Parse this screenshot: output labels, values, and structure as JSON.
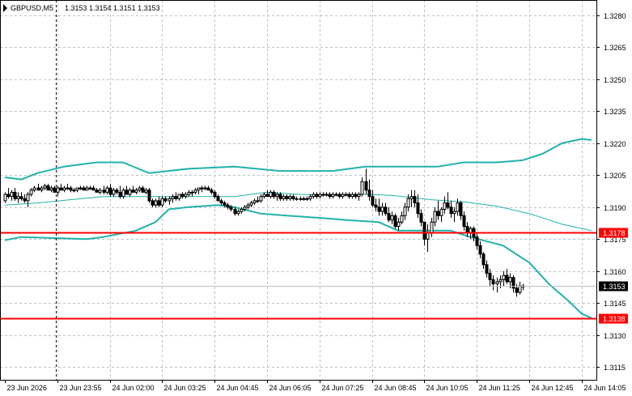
{
  "chart_data": {
    "type": "candlestick",
    "symbol_label": "GBPUSD,M5",
    "ohlc_label": "1.3153 1.3154 1.3151 1.3153",
    "y_ticks": [
      "1.3280",
      "1.3265",
      "1.3250",
      "1.3235",
      "1.3220",
      "1.3205",
      "1.3190",
      "1.3175",
      "1.3160",
      "1.3145",
      "1.3130",
      "1.3115"
    ],
    "y_tick_values": [
      1.328,
      1.3265,
      1.325,
      1.3235,
      1.322,
      1.3205,
      1.319,
      1.3175,
      1.316,
      1.3145,
      1.313,
      1.3115
    ],
    "ylim": [
      1.3109,
      1.32872
    ],
    "x_ticks": [
      "23 Jun 2026",
      "23 Jun 23:55",
      "24 Jun 02:00",
      "24 Jun 03:25",
      "24 Jun 04:45",
      "24 Jun 06:05",
      "24 Jun 07:25",
      "24 Jun 08:45",
      "24 Jun 10:05",
      "24 Jun 11:25",
      "24 Jun 12:45",
      "24 Jun 14:05"
    ],
    "x_tick_values": [
      0,
      16,
      32,
      48,
      64,
      80,
      96,
      112,
      128,
      144,
      160,
      176
    ],
    "xlim": [
      -1,
      184.2
    ],
    "levels": [
      {
        "label": "1.3178",
        "value": 1.3178,
        "color": "#ff0000"
      },
      {
        "label": "1.3138",
        "value": 1.3138,
        "color": "#ff0000"
      }
    ],
    "current_price": {
      "label": "1.3153",
      "value": 1.3153
    },
    "candles": [
      [
        1.3193,
        1.3197,
        1.3192,
        1.3196
      ],
      [
        1.3196,
        1.3199,
        1.3194,
        1.3195
      ],
      [
        1.3195,
        1.3198,
        1.3193,
        1.3197
      ],
      [
        1.3197,
        1.3199,
        1.3193,
        1.3194
      ],
      [
        1.3194,
        1.3197,
        1.3192,
        1.3195
      ],
      [
        1.3195,
        1.3197,
        1.3193,
        1.3194
      ],
      [
        1.3194,
        1.3196,
        1.3192,
        1.3193
      ],
      [
        1.3193,
        1.3197,
        1.319,
        1.3196
      ],
      [
        1.3196,
        1.3199,
        1.3195,
        1.3198
      ],
      [
        1.3198,
        1.32,
        1.3197,
        1.3199
      ],
      [
        1.3199,
        1.3201,
        1.3198,
        1.3198
      ],
      [
        1.3198,
        1.32,
        1.3197,
        1.3199
      ],
      [
        1.3199,
        1.3201,
        1.3198,
        1.32
      ],
      [
        1.32,
        1.3201,
        1.3198,
        1.3198
      ],
      [
        1.3198,
        1.32,
        1.3197,
        1.3199
      ],
      [
        1.3199,
        1.32,
        1.3197,
        1.3197
      ],
      [
        1.3197,
        1.32,
        1.3195,
        1.3199
      ],
      [
        1.3199,
        1.3201,
        1.3198,
        1.3198
      ],
      [
        1.3198,
        1.32,
        1.3197,
        1.3199
      ],
      [
        1.3199,
        1.3201,
        1.3198,
        1.3199
      ],
      [
        1.3199,
        1.32,
        1.3197,
        1.3198
      ],
      [
        1.3198,
        1.3199,
        1.3197,
        1.3198
      ],
      [
        1.3198,
        1.3199,
        1.3197,
        1.3199
      ],
      [
        1.3199,
        1.32,
        1.3198,
        1.3199
      ],
      [
        1.3199,
        1.32,
        1.3198,
        1.3198
      ],
      [
        1.3198,
        1.32,
        1.3198,
        1.3199
      ],
      [
        1.3199,
        1.32,
        1.3198,
        1.3199
      ],
      [
        1.3199,
        1.32,
        1.3198,
        1.3198
      ],
      [
        1.3198,
        1.3199,
        1.3197,
        1.3197
      ],
      [
        1.3197,
        1.3199,
        1.3196,
        1.3198
      ],
      [
        1.3198,
        1.32,
        1.3196,
        1.3197
      ],
      [
        1.3197,
        1.32,
        1.3196,
        1.3199
      ],
      [
        1.3199,
        1.3201,
        1.3195,
        1.3196
      ],
      [
        1.3196,
        1.3199,
        1.3195,
        1.3198
      ],
      [
        1.3198,
        1.3199,
        1.3196,
        1.3197
      ],
      [
        1.3197,
        1.32,
        1.3194,
        1.3195
      ],
      [
        1.3195,
        1.3199,
        1.3194,
        1.3198
      ],
      [
        1.3198,
        1.32,
        1.3196,
        1.3196
      ],
      [
        1.3196,
        1.3199,
        1.3195,
        1.3198
      ],
      [
        1.3198,
        1.32,
        1.3197,
        1.3197
      ],
      [
        1.3197,
        1.3199,
        1.3196,
        1.3198
      ],
      [
        1.3198,
        1.32,
        1.3197,
        1.3199
      ],
      [
        1.3199,
        1.32,
        1.3197,
        1.3197
      ],
      [
        1.3197,
        1.3199,
        1.3196,
        1.3198
      ],
      [
        1.3198,
        1.3199,
        1.3192,
        1.3193
      ],
      [
        1.3193,
        1.3194,
        1.319,
        1.3191
      ],
      [
        1.3191,
        1.3194,
        1.319,
        1.3193
      ],
      [
        1.3193,
        1.3195,
        1.319,
        1.3191
      ],
      [
        1.3191,
        1.3195,
        1.319,
        1.3194
      ],
      [
        1.3194,
        1.3195,
        1.3192,
        1.3193
      ],
      [
        1.3193,
        1.3195,
        1.3191,
        1.3194
      ],
      [
        1.3194,
        1.3196,
        1.3192,
        1.3195
      ],
      [
        1.3195,
        1.3197,
        1.3193,
        1.3194
      ],
      [
        1.3194,
        1.3196,
        1.3193,
        1.3196
      ],
      [
        1.3196,
        1.3197,
        1.3194,
        1.3195
      ],
      [
        1.3195,
        1.3197,
        1.3194,
        1.3196
      ],
      [
        1.3196,
        1.3198,
        1.3195,
        1.3197
      ],
      [
        1.3197,
        1.3198,
        1.3195,
        1.3197
      ],
      [
        1.3197,
        1.3199,
        1.3196,
        1.3198
      ],
      [
        1.3198,
        1.3199,
        1.3196,
        1.3199
      ],
      [
        1.3199,
        1.32,
        1.3197,
        1.3199
      ],
      [
        1.3199,
        1.32,
        1.3198,
        1.3199
      ],
      [
        1.3199,
        1.32,
        1.3198,
        1.3198
      ],
      [
        1.3198,
        1.3199,
        1.3196,
        1.3197
      ],
      [
        1.3197,
        1.3198,
        1.3194,
        1.3195
      ],
      [
        1.3195,
        1.3196,
        1.3193,
        1.3193
      ],
      [
        1.3193,
        1.3194,
        1.3191,
        1.3192
      ],
      [
        1.3192,
        1.3193,
        1.319,
        1.3191
      ],
      [
        1.3191,
        1.3192,
        1.3189,
        1.319
      ],
      [
        1.319,
        1.3191,
        1.3188,
        1.3189
      ],
      [
        1.3189,
        1.319,
        1.3186,
        1.3187
      ],
      [
        1.3187,
        1.3189,
        1.3186,
        1.3188
      ],
      [
        1.3188,
        1.319,
        1.3187,
        1.3189
      ],
      [
        1.3189,
        1.3191,
        1.3188,
        1.319
      ],
      [
        1.319,
        1.3192,
        1.3189,
        1.3191
      ],
      [
        1.3191,
        1.3193,
        1.319,
        1.3192
      ],
      [
        1.3192,
        1.3194,
        1.3191,
        1.3193
      ],
      [
        1.3193,
        1.3195,
        1.3192,
        1.3193
      ],
      [
        1.3193,
        1.3196,
        1.3192,
        1.3195
      ],
      [
        1.3195,
        1.3197,
        1.3194,
        1.3196
      ],
      [
        1.3196,
        1.3198,
        1.3195,
        1.3195
      ],
      [
        1.3195,
        1.3198,
        1.3194,
        1.3197
      ],
      [
        1.3197,
        1.3198,
        1.3194,
        1.3195
      ],
      [
        1.3195,
        1.3197,
        1.3193,
        1.3196
      ],
      [
        1.3196,
        1.3197,
        1.3193,
        1.3194
      ],
      [
        1.3194,
        1.3196,
        1.3193,
        1.3195
      ],
      [
        1.3195,
        1.3196,
        1.3193,
        1.3194
      ],
      [
        1.3194,
        1.3196,
        1.3193,
        1.3195
      ],
      [
        1.3195,
        1.3196,
        1.3193,
        1.3194
      ],
      [
        1.3194,
        1.3195,
        1.3193,
        1.3194
      ],
      [
        1.3194,
        1.3195,
        1.3193,
        1.3194
      ],
      [
        1.3194,
        1.3195,
        1.3193,
        1.3194
      ],
      [
        1.3194,
        1.3195,
        1.3193,
        1.3194
      ],
      [
        1.3194,
        1.3196,
        1.3193,
        1.3195
      ],
      [
        1.3195,
        1.3197,
        1.3194,
        1.3196
      ],
      [
        1.3196,
        1.3197,
        1.3194,
        1.3195
      ],
      [
        1.3195,
        1.3197,
        1.3194,
        1.3196
      ],
      [
        1.3196,
        1.3197,
        1.3195,
        1.3196
      ],
      [
        1.3196,
        1.3197,
        1.3195,
        1.3196
      ],
      [
        1.3196,
        1.3197,
        1.3194,
        1.3195
      ],
      [
        1.3195,
        1.3197,
        1.3194,
        1.3196
      ],
      [
        1.3196,
        1.3197,
        1.3195,
        1.3196
      ],
      [
        1.3196,
        1.3197,
        1.3194,
        1.3195
      ],
      [
        1.3195,
        1.3197,
        1.3194,
        1.3196
      ],
      [
        1.3196,
        1.3197,
        1.3195,
        1.3196
      ],
      [
        1.3196,
        1.3197,
        1.3194,
        1.3195
      ],
      [
        1.3195,
        1.3197,
        1.3194,
        1.3196
      ],
      [
        1.3196,
        1.3197,
        1.3194,
        1.3195
      ],
      [
        1.3195,
        1.3197,
        1.3193,
        1.3196
      ],
      [
        1.3196,
        1.3204,
        1.3195,
        1.3202
      ],
      [
        1.3202,
        1.3208,
        1.3196,
        1.3198
      ],
      [
        1.3198,
        1.3203,
        1.3193,
        1.3195
      ],
      [
        1.3195,
        1.3198,
        1.319,
        1.3191
      ],
      [
        1.3191,
        1.3194,
        1.3188,
        1.319
      ],
      [
        1.319,
        1.3194,
        1.3186,
        1.3188
      ],
      [
        1.3188,
        1.3192,
        1.3186,
        1.319
      ],
      [
        1.319,
        1.3192,
        1.3186,
        1.3187
      ],
      [
        1.3187,
        1.319,
        1.3183,
        1.3184
      ],
      [
        1.3184,
        1.3188,
        1.3182,
        1.3186
      ],
      [
        1.3186,
        1.3187,
        1.318,
        1.3181
      ],
      [
        1.3181,
        1.3185,
        1.3179,
        1.3183
      ],
      [
        1.3183,
        1.3188,
        1.3182,
        1.3186
      ],
      [
        1.3186,
        1.3192,
        1.3184,
        1.319
      ],
      [
        1.319,
        1.3196,
        1.3188,
        1.3194
      ],
      [
        1.3194,
        1.3198,
        1.319,
        1.3195
      ],
      [
        1.3195,
        1.3198,
        1.319,
        1.3192
      ],
      [
        1.3192,
        1.3196,
        1.3185,
        1.3187
      ],
      [
        1.3187,
        1.3189,
        1.3181,
        1.3183
      ],
      [
        1.3183,
        1.3181,
        1.3172,
        1.3175
      ],
      [
        1.3175,
        1.3182,
        1.3169,
        1.3178
      ],
      [
        1.3178,
        1.3185,
        1.3176,
        1.3183
      ],
      [
        1.3183,
        1.319,
        1.3181,
        1.3188
      ],
      [
        1.3188,
        1.3193,
        1.3184,
        1.3186
      ],
      [
        1.3186,
        1.319,
        1.3183,
        1.3189
      ],
      [
        1.3189,
        1.3195,
        1.3187,
        1.3192
      ],
      [
        1.3192,
        1.3197,
        1.3189,
        1.319
      ],
      [
        1.319,
        1.3193,
        1.3185,
        1.3187
      ],
      [
        1.3187,
        1.319,
        1.3183,
        1.3188
      ],
      [
        1.3188,
        1.3194,
        1.3186,
        1.3192
      ],
      [
        1.3192,
        1.3193,
        1.3184,
        1.3186
      ],
      [
        1.3186,
        1.3188,
        1.3179,
        1.3181
      ],
      [
        1.3181,
        1.3183,
        1.3176,
        1.3178
      ],
      [
        1.3178,
        1.3181,
        1.3175,
        1.318
      ],
      [
        1.318,
        1.3181,
        1.3174,
        1.3176
      ],
      [
        1.3176,
        1.3178,
        1.317,
        1.3172
      ],
      [
        1.3172,
        1.3174,
        1.3166,
        1.3168
      ],
      [
        1.3168,
        1.3169,
        1.3161,
        1.3163
      ],
      [
        1.3163,
        1.3165,
        1.3157,
        1.3159
      ],
      [
        1.3159,
        1.3161,
        1.3153,
        1.3156
      ],
      [
        1.3156,
        1.3158,
        1.3151,
        1.3154
      ],
      [
        1.3154,
        1.3157,
        1.315,
        1.3155
      ],
      [
        1.3155,
        1.3158,
        1.3152,
        1.3156
      ],
      [
        1.3156,
        1.316,
        1.3153,
        1.3158
      ],
      [
        1.3158,
        1.3161,
        1.3154,
        1.3155
      ],
      [
        1.3155,
        1.3159,
        1.3152,
        1.3157
      ],
      [
        1.3157,
        1.3158,
        1.315,
        1.3152
      ],
      [
        1.3152,
        1.3154,
        1.3148,
        1.315
      ],
      [
        1.315,
        1.3155,
        1.3149,
        1.3153
      ],
      [
        1.3153,
        1.3154,
        1.3151,
        1.3153
      ]
    ],
    "bands": {
      "color": "#20b2aa",
      "upper": [
        [
          0,
          1.3204
        ],
        [
          5,
          1.3203
        ],
        [
          10,
          1.3206
        ],
        [
          18,
          1.3209
        ],
        [
          28,
          1.3211
        ],
        [
          36,
          1.3211
        ],
        [
          44,
          1.3206
        ],
        [
          56,
          1.3208
        ],
        [
          70,
          1.3209
        ],
        [
          84,
          1.3207
        ],
        [
          100,
          1.3207
        ],
        [
          110,
          1.3209
        ],
        [
          114,
          1.3209
        ],
        [
          124,
          1.3209
        ],
        [
          132,
          1.3209
        ],
        [
          140,
          1.3211
        ],
        [
          150,
          1.3211
        ],
        [
          158,
          1.3212
        ],
        [
          164,
          1.3215
        ],
        [
          170,
          1.322
        ],
        [
          176,
          1.3222
        ],
        [
          179,
          1.32215
        ]
      ],
      "middle": [
        [
          0,
          1.3191
        ],
        [
          10,
          1.3192
        ],
        [
          20,
          1.31935
        ],
        [
          30,
          1.3195
        ],
        [
          40,
          1.3195
        ],
        [
          50,
          1.3195
        ],
        [
          60,
          1.3195
        ],
        [
          70,
          1.3195
        ],
        [
          80,
          1.3197
        ],
        [
          90,
          1.3196
        ],
        [
          100,
          1.31955
        ],
        [
          110,
          1.3196
        ],
        [
          118,
          1.31955
        ],
        [
          130,
          1.31935
        ],
        [
          140,
          1.31925
        ],
        [
          150,
          1.31905
        ],
        [
          160,
          1.3187
        ],
        [
          170,
          1.3182
        ],
        [
          179,
          1.3179
        ]
      ],
      "lower": [
        [
          0,
          1.31745
        ],
        [
          5,
          1.3176
        ],
        [
          15,
          1.31755
        ],
        [
          25,
          1.3175
        ],
        [
          30,
          1.3176
        ],
        [
          40,
          1.3179
        ],
        [
          46,
          1.3183
        ],
        [
          50,
          1.3189
        ],
        [
          56,
          1.319
        ],
        [
          65,
          1.3191
        ],
        [
          70,
          1.319
        ],
        [
          78,
          1.3187
        ],
        [
          86,
          1.3186
        ],
        [
          96,
          1.3185
        ],
        [
          104,
          1.3184
        ],
        [
          114,
          1.3183
        ],
        [
          120,
          1.3179
        ],
        [
          128,
          1.3179
        ],
        [
          136,
          1.3179
        ],
        [
          142,
          1.3176
        ],
        [
          152,
          1.3172
        ],
        [
          160,
          1.3164
        ],
        [
          166,
          1.3154
        ],
        [
          172,
          1.3146
        ],
        [
          176,
          1.314
        ],
        [
          179,
          1.3138
        ]
      ]
    }
  }
}
